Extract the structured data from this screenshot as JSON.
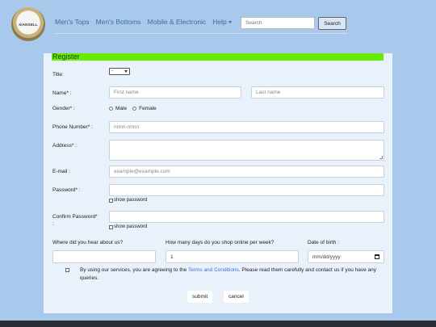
{
  "logo": {
    "text": "XIANSELL"
  },
  "nav": {
    "links": [
      "Men's Tops",
      "Men's Bottoms",
      "Mobile & Electronic",
      "Help"
    ],
    "search_placeholder": "Search",
    "search_button": "Search"
  },
  "form": {
    "title": "Register",
    "title_label": "Title:",
    "title_value": "-",
    "name_label": "Name* :",
    "first_name_placeholder": "First name",
    "last_name_placeholder": "Last name",
    "gender_label": "Gender* :",
    "gender_options": [
      "Male",
      "Female"
    ],
    "phone_label": "Phone Number* :",
    "phone_placeholder": "nnnn-nnnn",
    "address_label": "Address* :",
    "email_label": "E-mail :",
    "email_placeholder": "example@example.com",
    "password_label": "Password* :",
    "show_password_1": "show password",
    "confirm_label": "Confirm Password*",
    "confirm_label_2": ":",
    "show_password_2": "show password",
    "hear_label": "Where did you hear about us?",
    "days_label": "How many days do you shop online per week?",
    "days_value": "1",
    "dob_label": "Date of birth :",
    "dob_placeholder": "mm/dd/yyyy",
    "terms_before": "By using our services, you are agreeing to the ",
    "terms_link": "Terms and Conditions",
    "terms_after": ". Please read them carefully and contact us if you have any queries.",
    "submit": "submit",
    "cancel": "cancel"
  },
  "colors": {
    "background": "#a8c8ec",
    "panel": "#e9f1fb",
    "header_bar": "#66ee00",
    "link": "#3f6fd0"
  }
}
